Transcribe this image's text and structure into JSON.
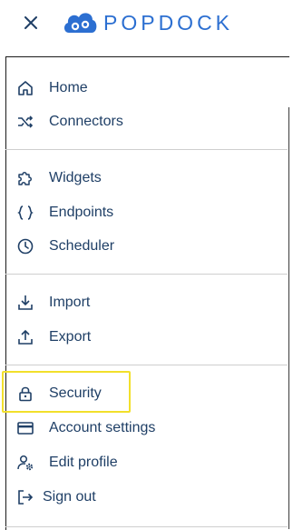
{
  "app": {
    "logo_text": "POPDOCK"
  },
  "menu": {
    "home": "Home",
    "connectors": "Connectors",
    "widgets": "Widgets",
    "endpoints": "Endpoints",
    "scheduler": "Scheduler",
    "import": "Import",
    "export": "Export",
    "security": "Security",
    "account_settings": "Account settings",
    "edit_profile": "Edit profile",
    "sign_out": "Sign out"
  },
  "highlighted_item": "Security",
  "colors": {
    "brand": "#2c6fd1",
    "text": "#1f3f66",
    "highlight": "#f2e02b"
  },
  "icons": {
    "close": "close-icon",
    "home": "home-icon",
    "connectors": "shuffle-icon",
    "widgets": "puzzle-icon",
    "endpoints": "braces-icon",
    "scheduler": "clock-icon",
    "import": "import-icon",
    "export": "export-icon",
    "security": "lock-icon",
    "account_settings": "credit-card-icon",
    "edit_profile": "user-gear-icon",
    "sign_out": "sign-out-icon"
  }
}
